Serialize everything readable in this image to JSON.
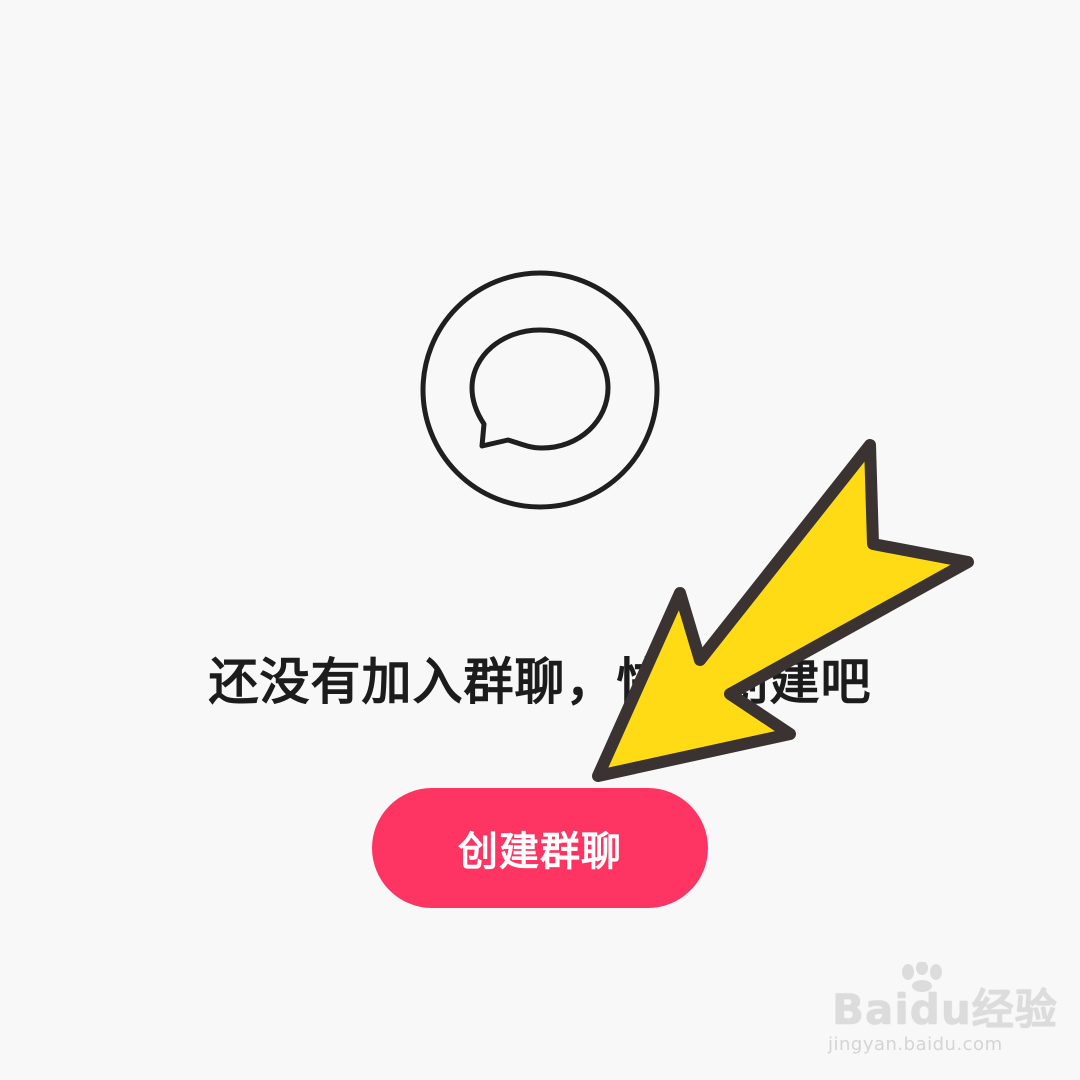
{
  "empty_state": {
    "icon": "chat-bubble-icon",
    "message": "还没有加入群聊，快去创建吧",
    "button_label": "创建群聊"
  },
  "annotation": {
    "icon": "yellow-arrow-icon"
  },
  "watermark": {
    "logo_text": "Baidu经验",
    "url": "jingyan.baidu.com"
  },
  "colors": {
    "background": "#f8f8f8",
    "button": "#fe3562",
    "arrow_fill": "#ffdb15",
    "arrow_stroke": "#3a3332",
    "text": "#1c1c1c"
  }
}
